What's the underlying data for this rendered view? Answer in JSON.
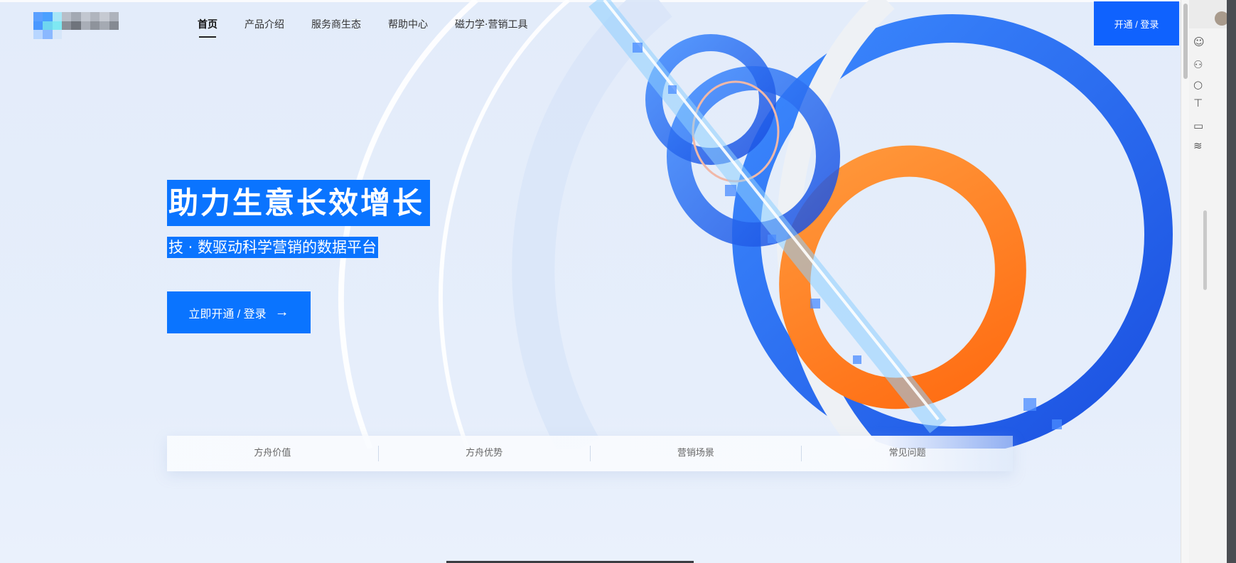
{
  "header": {
    "nav": [
      "首页",
      "产品介绍",
      "服务商生态",
      "帮助中心",
      "磁力学·营销工具"
    ],
    "active_nav": "首页",
    "login_label": "开通 / 登录"
  },
  "hero": {
    "title": "助力生意长效增长",
    "subtitle": "技 · 数驱动科学营销的数据平台",
    "cta_label": "立即开通 / 登录",
    "cta_icon": "arrow-right-icon"
  },
  "section_tabs": [
    "方舟价值",
    "方舟优势",
    "营销场景",
    "常见问题"
  ],
  "colors": {
    "primary": "#0a74ff",
    "login": "#0f62fe",
    "accent_orange": "#ff7d22"
  }
}
